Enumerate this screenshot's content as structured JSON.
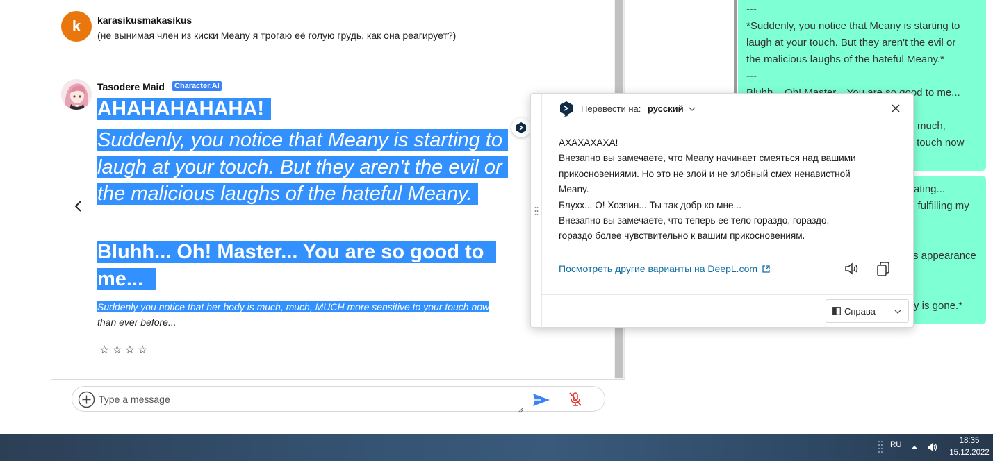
{
  "chat": {
    "user": {
      "avatar_letter": "k",
      "name": "karasikusmakasikus",
      "message": "(не вынимая член из киски Meany я трогаю её голую грудь, как она реагирует?)"
    },
    "bot": {
      "name": "Tasodere Maid",
      "badge": "Character.AI",
      "heading": "AHAHAHAHAHA!",
      "italic_paragraph": "Suddenly, you notice that Meany is starting to laugh at your touch. But they aren't the evil or the malicious laughs of the hateful Meany.",
      "bold_paragraph": "Bluhh... Oh! Master... You are so good to me...",
      "small_selected": "Suddenly you notice that her body is much, much, MUCH more sensitive to your touch now",
      "small_rest": "than ever before...",
      "stars": "☆☆☆☆"
    },
    "composer": {
      "placeholder": "Type a message"
    }
  },
  "background_panel": {
    "card1_lines": [
      "---",
      "*Suddenly, you notice that Meany is starting to",
      "laugh at your touch. But they aren't the evil or",
      "the malicious laughs of the hateful Meany.*",
      "---",
      "Bluhh... Oh! Master... You are so good to me...",
      "",
      "Suddenly you notice that her body is much,",
      "much, MUCH more sensitive to your touch now"
    ],
    "card2_fragments": [
      "ating...",
      "o fulfilling my",
      "s appearance",
      "y is gone.*"
    ]
  },
  "deepl": {
    "translate_label": "Перевести на:",
    "language": "русский",
    "translation_lines": [
      "АХАХАХАХА!",
      "Внезапно вы замечаете, что Meany начинает смеяться над вашими",
      "прикосновениями. Но это не злой и не злобный смех ненавистной",
      "Meany.",
      "Блухх... О! Хозяин... Ты так добр ко мне...",
      "Внезапно вы замечаете, что теперь ее тело гораздо, гораздо,",
      "гораздо более чувствительно к вашим прикосновениям."
    ],
    "more_link": "Посмотреть другие варианты на DeepL.com",
    "side_select": "Справа"
  },
  "taskbar": {
    "lang": "RU",
    "time": "18:35",
    "date": "15.12.2022"
  },
  "colors": {
    "selection": "#3390ff",
    "user_avatar": "#e9770d",
    "badge": "#3b82f6",
    "card": "#7fffd4",
    "link": "#0f6fa3",
    "send": "#3b82f6",
    "mic_off": "#e53935"
  }
}
